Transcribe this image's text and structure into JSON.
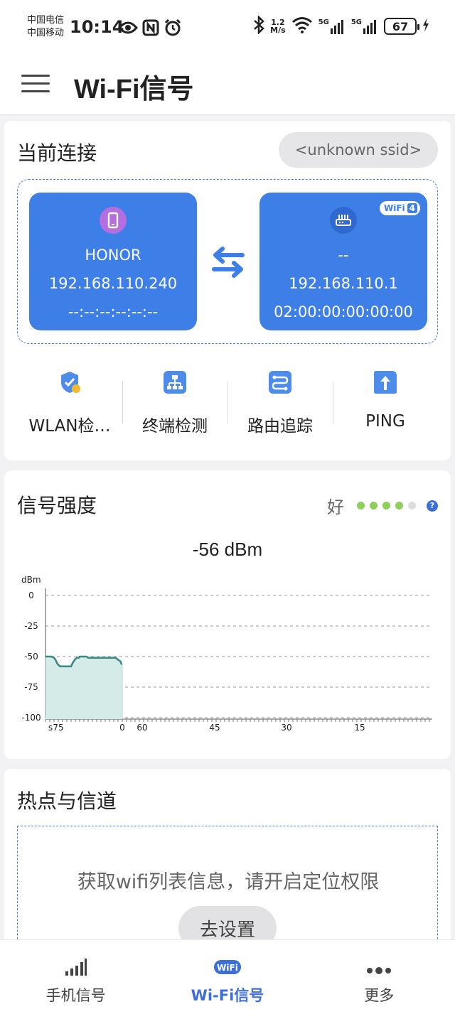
{
  "status_bar": {
    "carrier1": "中国电信",
    "carrier2": "中国移动",
    "time": "10:14",
    "net_speed_value": "1.2",
    "net_speed_unit": "M/s",
    "sim1_type": "5G",
    "sim2_type": "5G",
    "battery": "67"
  },
  "app_bar": {
    "title": "Wi-Fi信号"
  },
  "connection": {
    "title": "当前连接",
    "ssid": "<unknown ssid>",
    "device": {
      "name": "HONOR",
      "ip": "192.168.110.240",
      "mac": "--:--:--:--:--:--"
    },
    "router": {
      "name": "--",
      "ip": "192.168.110.1",
      "mac": "02:00:00:00:00:00",
      "badge_text": "WiFi",
      "badge_num": "4"
    }
  },
  "tools": [
    {
      "label": "WLAN检…",
      "icon": "wlan-check-icon"
    },
    {
      "label": "终端检测",
      "icon": "terminal-detect-icon"
    },
    {
      "label": "路由追踪",
      "icon": "route-trace-icon"
    },
    {
      "label": "PING",
      "icon": "ping-icon"
    }
  ],
  "signal": {
    "title": "信号强度",
    "quality_label": "好",
    "quality_level": 4,
    "quality_max": 5,
    "dbm": "-56  dBm",
    "colors": {
      "dot_on": "#8ccf5a",
      "dot_off": "#dcdcdc",
      "line": "#3b8a86",
      "fill": "#d4ebe8"
    }
  },
  "chart_data": {
    "type": "area",
    "ylabel": "dBm",
    "xlabel": "s",
    "ylim": [
      -100,
      0
    ],
    "y_ticks": [
      "0",
      "-25",
      "-50",
      "-75",
      "-100"
    ],
    "x_ticks_left": [
      "75",
      "0"
    ],
    "x_ticks_right": [
      "60",
      "45",
      "30",
      "15"
    ],
    "series": [
      {
        "x": [
          90,
          87,
          85,
          83,
          80,
          78,
          76,
          73,
          70,
          67,
          65,
          62,
          60,
          58,
          55,
          53,
          51,
          50,
          48,
          46,
          44,
          42,
          40,
          38,
          37,
          36,
          34,
          32,
          30,
          28,
          26,
          24,
          22,
          20,
          18,
          16,
          14,
          12,
          10,
          8,
          6,
          4,
          2,
          1,
          0
        ],
        "values": [
          -50,
          -50,
          -50,
          -50,
          -51,
          -53,
          -56,
          -58,
          -58,
          -58,
          -58,
          -58,
          -58,
          -55,
          -52,
          -51,
          -51,
          -50,
          -50,
          -50,
          -50,
          -50,
          -51,
          -51,
          -51,
          -51,
          -51,
          -51,
          -51,
          -51,
          -51,
          -51,
          -51,
          -51,
          -51,
          -51,
          -51,
          -51,
          -51,
          -51,
          -52,
          -53,
          -54,
          -56,
          -56
        ]
      }
    ]
  },
  "hotspot": {
    "title": "热点与信道",
    "message": "获取wifi列表信息，请开启定位权限",
    "button": "去设置"
  },
  "bottom_nav": [
    {
      "label": "手机信号",
      "icon": "signal-bars-icon",
      "active": false
    },
    {
      "label": "Wi-Fi信号",
      "icon": "wifi-badge-icon",
      "active": true
    },
    {
      "label": "更多",
      "icon": "more-dots-icon",
      "active": false
    }
  ]
}
